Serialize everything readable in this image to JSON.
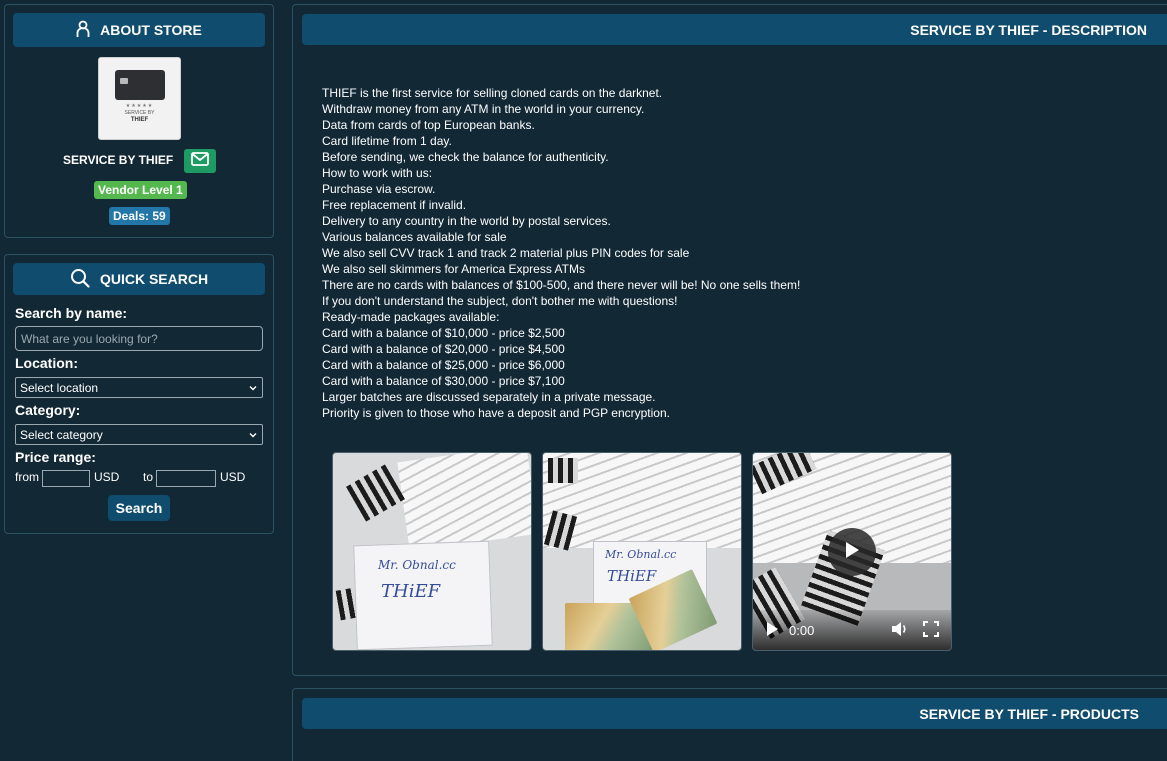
{
  "about": {
    "header": "ABOUT STORE",
    "thumb_stars": "★★★★★",
    "thumb_line1": "SERVICE BY",
    "thumb_line2": "THIEF",
    "store_name": "SERVICE BY THIEF",
    "vendor_level": "Vendor Level 1",
    "deals": "Deals: 59"
  },
  "search": {
    "header": "QUICK SEARCH",
    "name_label": "Search by name:",
    "name_placeholder": "What are you looking for?",
    "location_label": "Location:",
    "location_value": "Select location",
    "category_label": "Category:",
    "category_value": "Select category",
    "price_label": "Price range:",
    "from_label": "from",
    "to_label": "to",
    "currency": "USD",
    "button": "Search"
  },
  "description": {
    "header": "SERVICE BY THIEF - DESCRIPTION",
    "lines": [
      "THIEF is the first service for selling cloned cards on the darknet.",
      "Withdraw money from any ATM in the world in your currency.",
      "Data from cards of top European banks.",
      "Card lifetime from 1 day.",
      "Before sending, we check the balance for authenticity.",
      "How to work with us:",
      "Purchase via escrow.",
      "Free replacement if invalid.",
      "Delivery to any country in the world by postal services.",
      "Various balances available for sale",
      "We also sell CVV track 1 and track 2 material plus PIN codes for sale",
      "We also sell skimmers for America Express ATMs",
      "There are no cards with balances of $100-500, and there never will be! No one sells them!",
      "If you don't understand the subject, don't bother me with questions!",
      "Ready-made packages available:",
      "Card with a balance of $10,000 - price $2,500",
      "Card with a balance of $20,000 - price $4,500",
      "Card with a balance of $25,000 - price $6,000",
      "Card with a balance of $30,000 - price $7,100",
      "Larger batches are discussed separately in a private message.",
      "Priority is given to those who have a deposit and PGP encryption."
    ],
    "photo1_note1": "Mr. Obnal.cc",
    "photo1_note2": "THiEF",
    "photo2_note1": "Mr. Obnal.cc",
    "photo2_note2": "THiEF",
    "video_time": "0:00"
  },
  "products": {
    "header": "SERVICE BY THIEF - PRODUCTS"
  },
  "colors": {
    "background": "#122835",
    "header": "#0f4c6e",
    "vendor_badge": "#55b84f",
    "deals_badge": "#2376a8",
    "mail_button": "#1e9a63"
  }
}
